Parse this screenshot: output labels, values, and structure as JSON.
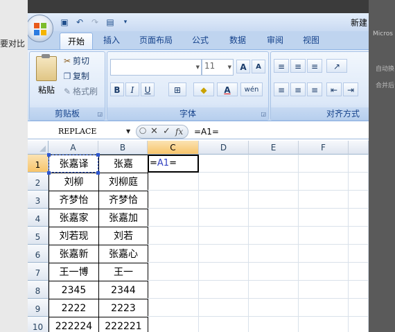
{
  "background_page": {
    "left_text": "要对比",
    "right_text": "Micros",
    "right_text2": "自动换",
    "right_text3": "合并后"
  },
  "window": {
    "title": "新建",
    "qat": [
      {
        "icon": "save-icon",
        "glyph": "▣"
      },
      {
        "icon": "undo-icon",
        "glyph": "↶"
      },
      {
        "icon": "redo-icon",
        "glyph": "↷"
      },
      {
        "icon": "print-preview-icon",
        "glyph": "▤"
      },
      {
        "icon": "qat-customize-icon",
        "glyph": "▾"
      }
    ]
  },
  "tabs": [
    "开始",
    "插入",
    "页面布局",
    "公式",
    "数据",
    "审阅",
    "视图"
  ],
  "active_tab": "开始",
  "ribbon": {
    "clipboard": {
      "label": "剪贴板",
      "paste": "粘贴",
      "cut": "剪切",
      "copy": "复制",
      "format_painter": "格式刷"
    },
    "font": {
      "label": "字体",
      "font_name": "",
      "font_size": "11",
      "grow": "A",
      "shrink": "A",
      "bold": "B",
      "italic": "I",
      "underline": "U",
      "wen": "wén",
      "font_color_letter": "A"
    },
    "alignment": {
      "label": "对齐方式"
    }
  },
  "formula_bar": {
    "name_box": "REPLACE",
    "cancel": "✕",
    "enter": "✓",
    "fx": "fx",
    "formula": "=A1="
  },
  "sheet": {
    "columns": [
      "A",
      "B",
      "C",
      "D",
      "E",
      "F"
    ],
    "selected_column": "C",
    "rows": [
      "1",
      "2",
      "3",
      "4",
      "5",
      "6",
      "7",
      "8",
      "9",
      "10"
    ],
    "selected_row": "1",
    "data": [
      [
        "张嘉译",
        "张嘉"
      ],
      [
        "刘柳",
        "刘柳庭"
      ],
      [
        "齐梦怡",
        "齐梦恰"
      ],
      [
        "张嘉家",
        "张嘉加"
      ],
      [
        "刘若现",
        "刘若"
      ],
      [
        "张嘉新",
        "张嘉心"
      ],
      [
        "王一博",
        "王一"
      ],
      [
        "2345",
        "2344"
      ],
      [
        "2222",
        "2223"
      ],
      [
        "222224",
        "222221"
      ]
    ],
    "c1_edit": {
      "prefix": "=",
      "ref": "A1",
      "suffix": "="
    }
  }
}
